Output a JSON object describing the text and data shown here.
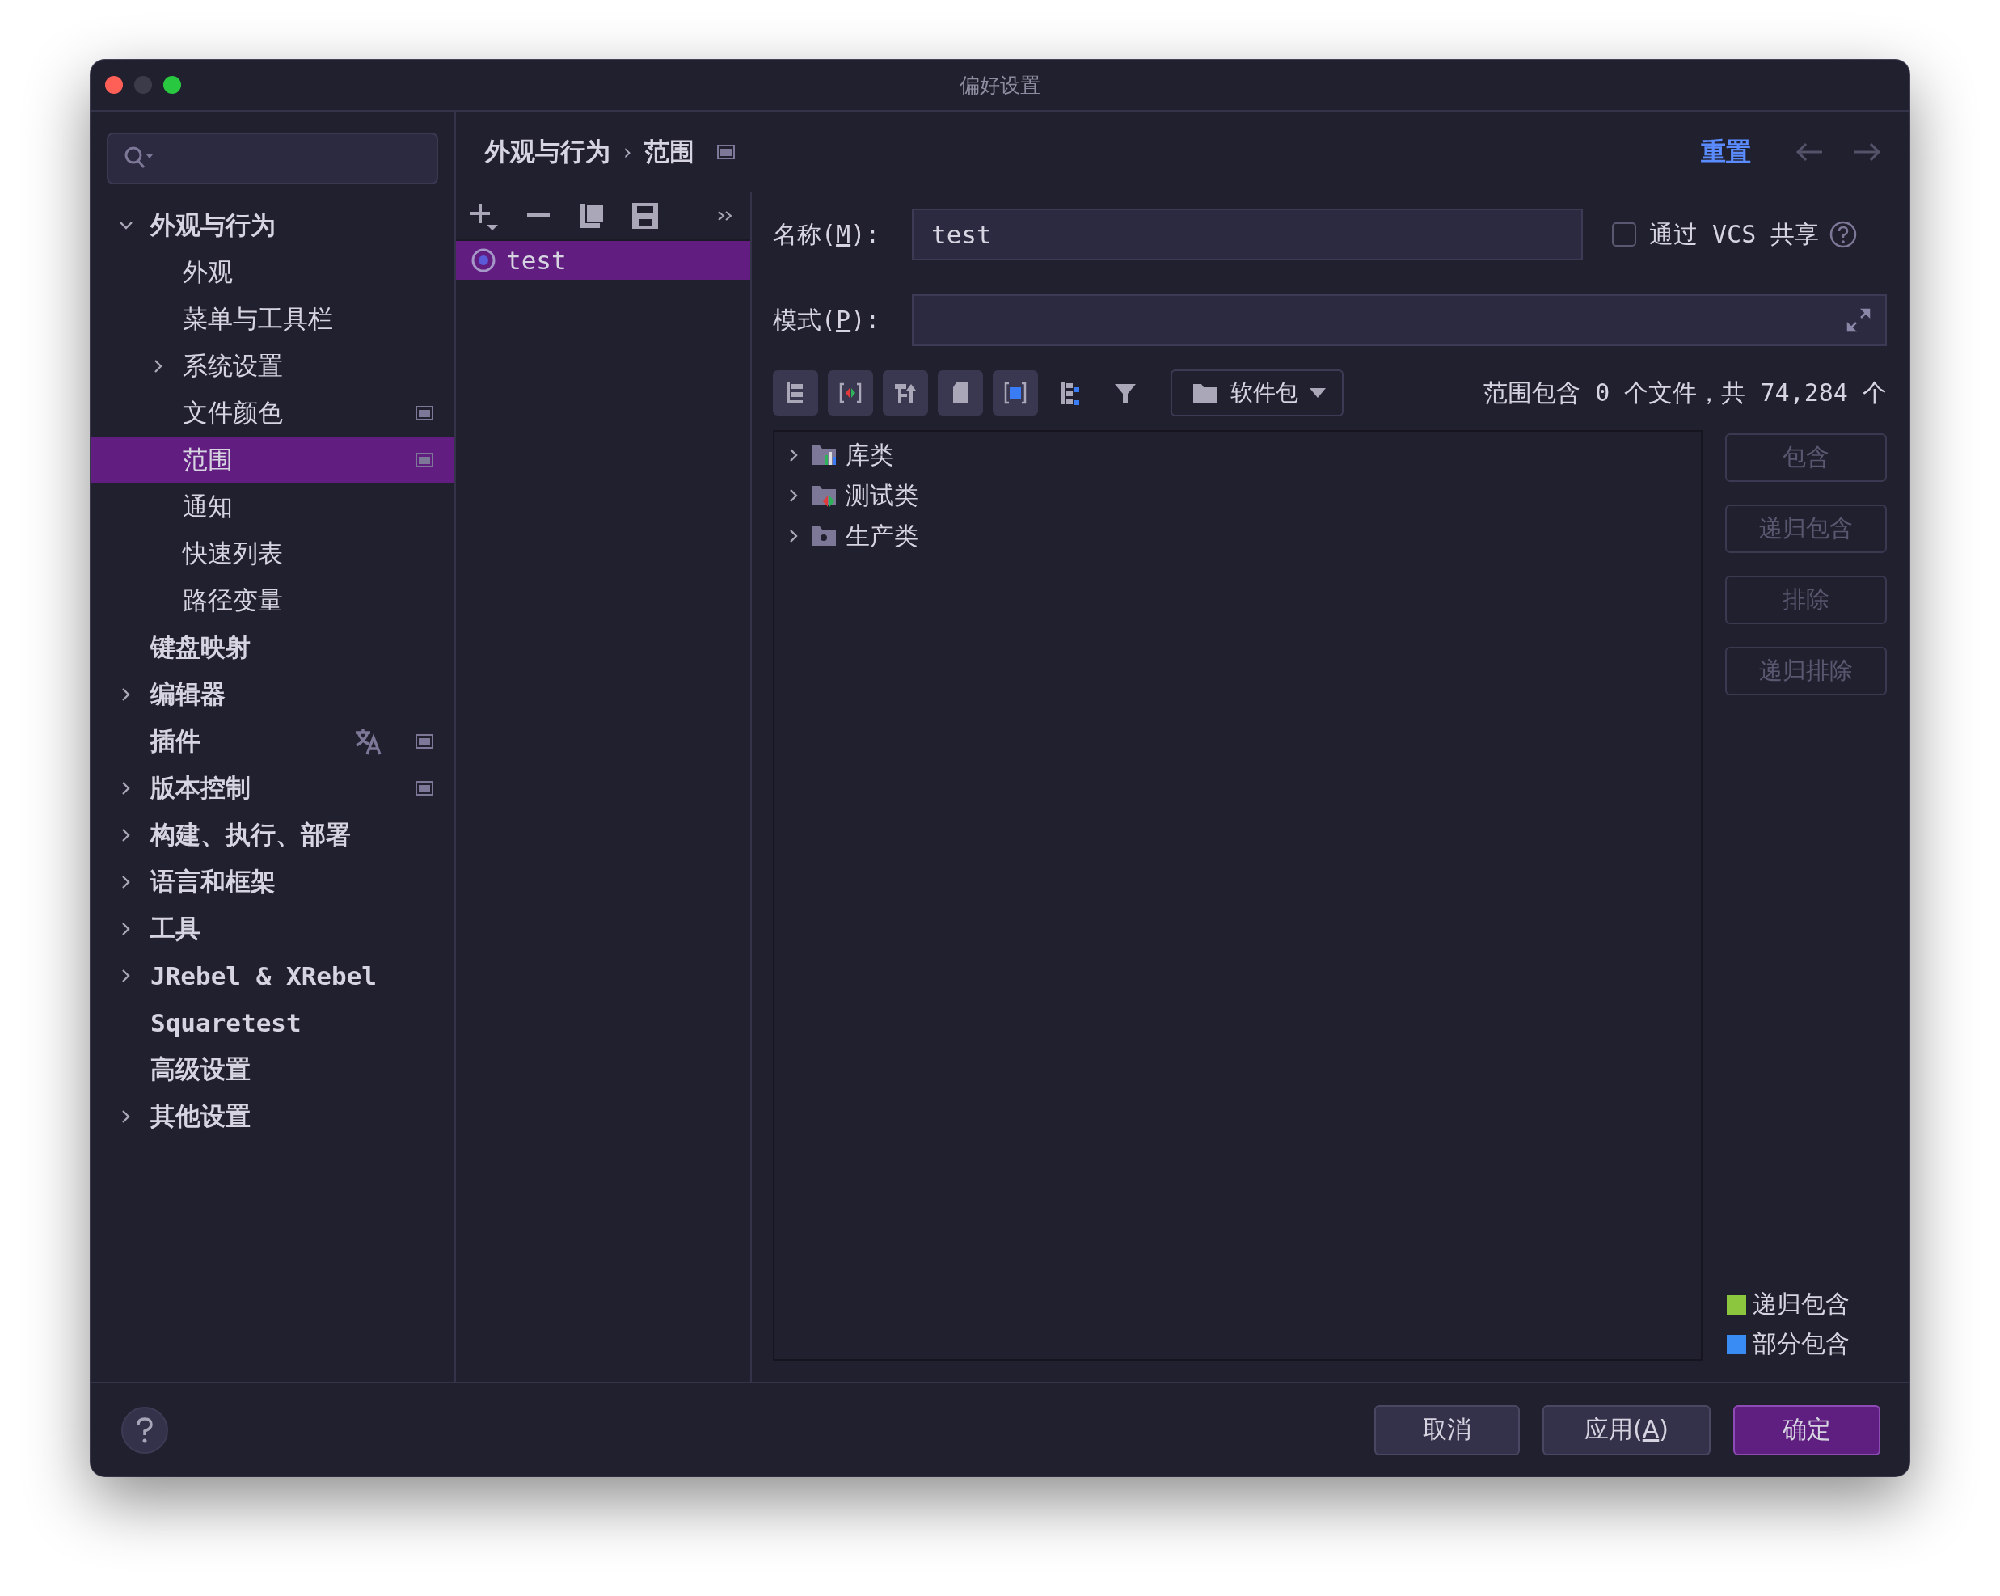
{
  "window": {
    "title": "偏好设置"
  },
  "sidebar": {
    "items": [
      {
        "label": "外观与行为",
        "expanded": true,
        "children": [
          {
            "label": "外观",
            "selected": false
          },
          {
            "label": "菜单与工具栏",
            "selected": false
          },
          {
            "label": "系统设置",
            "expanded": false,
            "selected": false
          },
          {
            "label": "文件颜色",
            "project_badge": true,
            "selected": false
          },
          {
            "label": "范围",
            "project_badge": true,
            "selected": true
          },
          {
            "label": "通知",
            "selected": false
          },
          {
            "label": "快速列表",
            "selected": false
          },
          {
            "label": "路径变量",
            "selected": false
          }
        ],
        "selected": false
      },
      {
        "label": "键盘映射",
        "selected": false
      },
      {
        "label": "编辑器",
        "expanded": false,
        "selected": false
      },
      {
        "label": "插件",
        "translated": true,
        "project_badge": true,
        "selected": false
      },
      {
        "label": "版本控制",
        "expanded": false,
        "project_badge": true,
        "selected": false
      },
      {
        "label": "构建、执行、部署",
        "expanded": false,
        "selected": false
      },
      {
        "label": "语言和框架",
        "expanded": false,
        "selected": false
      },
      {
        "label": "工具",
        "expanded": false,
        "selected": false
      },
      {
        "label": "JRebel & XRebel",
        "expanded": false,
        "selected": false
      },
      {
        "label": "Squaretest",
        "selected": false
      },
      {
        "label": "高级设置",
        "selected": false
      },
      {
        "label": "其他设置",
        "expanded": false,
        "selected": false
      }
    ]
  },
  "breadcrumb": [
    "外观与行为",
    "范围"
  ],
  "breadcrumb_separator": "›",
  "reset_link": "重置",
  "scopes": [
    {
      "name": "test",
      "selected": true
    }
  ],
  "form": {
    "name": {
      "before": "名称(",
      "mnemonic": "M",
      "after": "):",
      "value": "test"
    },
    "share": {
      "label": "通过 VCS 共享",
      "checked": false
    },
    "pattern": {
      "before": "模式(",
      "mnemonic": "P",
      "after": "):"
    }
  },
  "scope_toolbar": [
    {
      "on": true
    },
    {
      "on": true
    },
    {
      "on": true
    },
    {
      "on": true
    },
    {
      "on": true
    },
    {
      "on": false
    },
    {
      "on": false
    }
  ],
  "package_dropdown": "软件包",
  "summary": "范围包含 0 个文件，共 74,284 个",
  "tree": [
    {
      "label": "库类",
      "kind": "library",
      "expanded": false
    },
    {
      "label": "测试类",
      "kind": "test",
      "expanded": false
    },
    {
      "label": "生产类",
      "kind": "production",
      "expanded": false
    }
  ],
  "side_buttons": [
    {
      "label": "包含",
      "disabled": true
    },
    {
      "label": "递归包含",
      "disabled": true
    },
    {
      "label": "排除",
      "disabled": true
    },
    {
      "label": "递归排除",
      "disabled": true
    }
  ],
  "legend": [
    {
      "label": "递归包含",
      "color": "#8cc63f"
    },
    {
      "label": "部分包含",
      "color": "#3a8cf5"
    }
  ],
  "footer_buttons": [
    {
      "kind": "secondary",
      "before": "取消"
    },
    {
      "kind": "secondary",
      "before": "应用(",
      "mnemonic": "A",
      "after": ")"
    },
    {
      "kind": "primary",
      "before": "确定"
    }
  ]
}
